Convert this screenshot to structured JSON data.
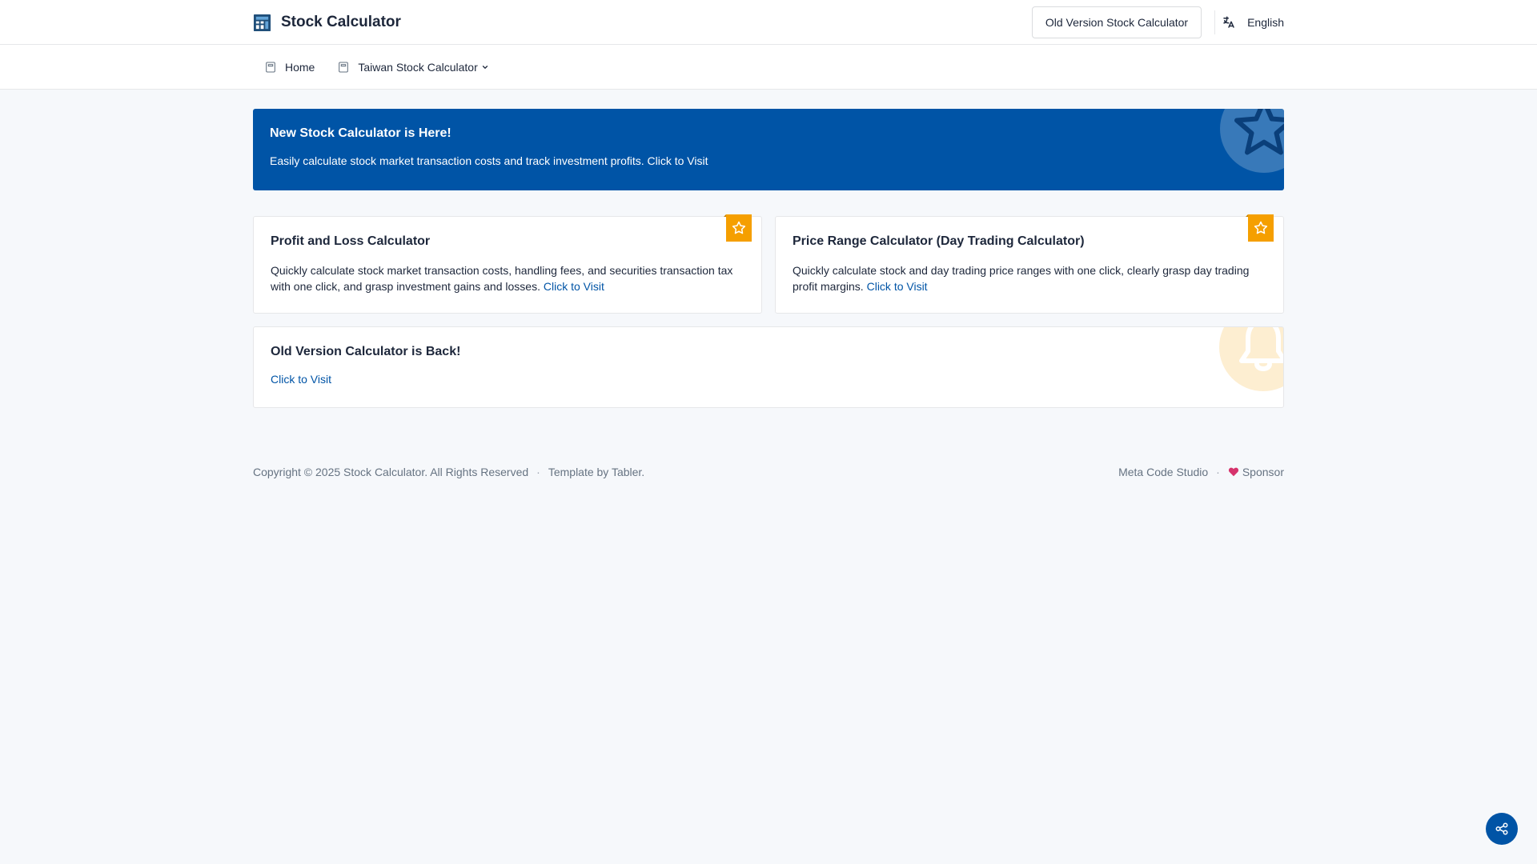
{
  "header": {
    "brand_title": "Stock Calculator",
    "brand_icon": "calculator-icon",
    "old_version_button": "Old Version Stock Calculator",
    "language_label": "English",
    "language_icon": "translate-icon"
  },
  "nav": {
    "items": [
      {
        "label": "Home",
        "icon": "calculator-icon"
      },
      {
        "label": "Taiwan Stock Calculator",
        "icon": "calculator-icon",
        "dropdown": true
      }
    ]
  },
  "banner": {
    "title": "New Stock Calculator is Here!",
    "text": "Easily calculate stock market transaction costs and track investment profits. Click to Visit",
    "icon": "star-icon",
    "color": "#0054a6"
  },
  "cards": [
    {
      "title": "Profit and Loss Calculator",
      "text": "Quickly calculate stock market transaction costs, handling fees, and securities transaction tax with one click, and grasp investment gains and losses.",
      "link": "Click to Visit",
      "ribbon_icon": "star-icon"
    },
    {
      "title": "Price Range Calculator (Day Trading Calculator)",
      "text": "Quickly calculate stock and day trading price ranges with one click, clearly grasp day trading profit margins.",
      "link": "Click to Visit",
      "ribbon_icon": "star-icon"
    }
  ],
  "old_version_card": {
    "title": "Old Version Calculator is Back!",
    "link": "Click to Visit",
    "icon": "bell-icon"
  },
  "footer": {
    "copyright": "Copyright © 2025 Stock Calculator. All Rights Reserved",
    "template": "Template by Tabler.",
    "studio": "Meta Code Studio",
    "sponsor": "Sponsor"
  },
  "fab": {
    "icon": "share-icon"
  },
  "colors": {
    "primary": "#0054a6",
    "ribbon": "#f59f00",
    "heart": "#d6336c"
  }
}
